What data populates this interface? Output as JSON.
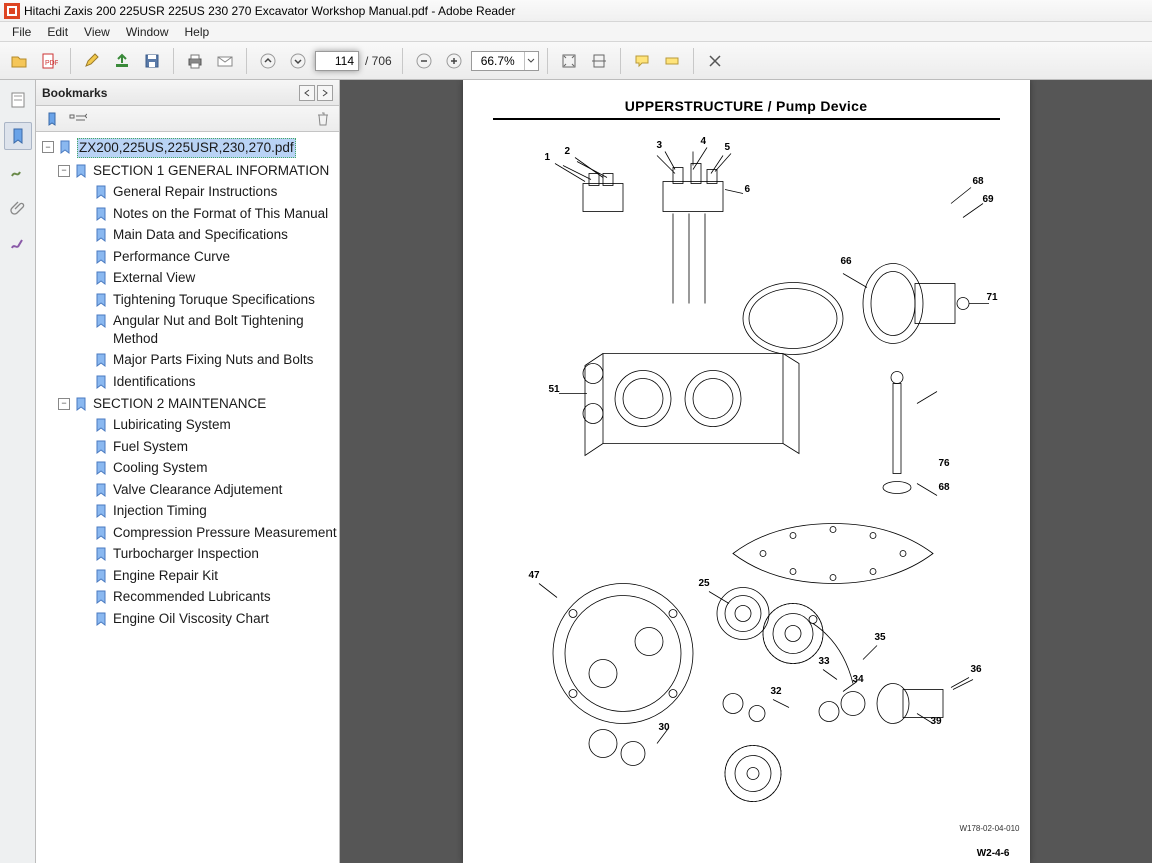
{
  "titlebar": {
    "title": "Hitachi Zaxis 200 225USR 225US 230 270 Excavator Workshop Manual.pdf - Adobe Reader"
  },
  "menubar": {
    "items": [
      "File",
      "Edit",
      "View",
      "Window",
      "Help"
    ]
  },
  "toolbar": {
    "page_current": "114",
    "page_total": "/ 706",
    "zoom": "66.7%"
  },
  "bookmarks": {
    "panel_title": "Bookmarks",
    "root": {
      "label": "ZX200,225US,225USR,230,270.pdf",
      "selected": true
    },
    "sections": [
      {
        "label": "SECTION 1 GENERAL INFORMATION",
        "items": [
          "General Repair Instructions",
          "Notes on the Format of This Manual",
          "Main Data and Specifications",
          "Performance Curve",
          "External View",
          "Tightening Toruque Specifications",
          "Angular Nut and Bolt Tightening Method",
          "Major Parts Fixing Nuts and Bolts",
          "Identifications"
        ]
      },
      {
        "label": "SECTION 2 MAINTENANCE",
        "items": [
          "Lubiricating System",
          "Fuel System",
          "Cooling System",
          "Valve Clearance Adjutement",
          "Injection Timing",
          "Compression Pressure Measurement",
          "Turbocharger Inspection",
          "Engine Repair Kit",
          "Recommended Lubricants",
          "Engine Oil Viscosity Chart"
        ]
      }
    ]
  },
  "page": {
    "title": "UPPERSTRUCTURE / Pump Device",
    "callouts": [
      "1",
      "2",
      "3",
      "4",
      "5",
      "6",
      "25",
      "30",
      "32",
      "33",
      "34",
      "35",
      "36",
      "39",
      "47",
      "51",
      "66",
      "68",
      "69",
      "71",
      "76",
      "68"
    ],
    "figref": "W178-02-04-010",
    "pagenum": "W2-4-6"
  }
}
